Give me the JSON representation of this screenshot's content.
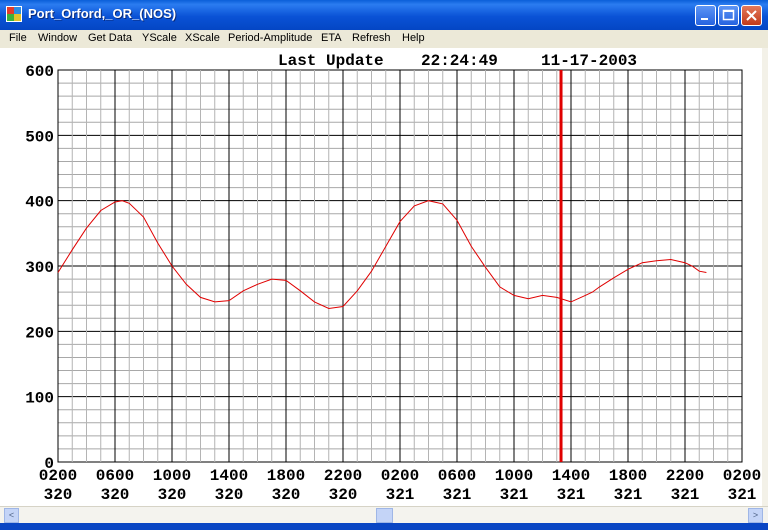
{
  "window": {
    "title": "Port_Orford,_OR_(NOS)"
  },
  "menu": [
    "File",
    "Window",
    "Get Data",
    "YScale",
    "XScale",
    "Period-Amplitude",
    "ETA",
    "Refresh",
    "Help"
  ],
  "header": {
    "label": "Last Update",
    "time": "22:24:49",
    "date": "11-17-2003"
  },
  "chart_data": {
    "type": "line",
    "y_ticks": [
      "0",
      "100",
      "200",
      "300",
      "400",
      "500",
      "600"
    ],
    "ylim": [
      0,
      600
    ],
    "x_ticks": [
      {
        "time": "0200",
        "day": "320"
      },
      {
        "time": "0600",
        "day": "320"
      },
      {
        "time": "1000",
        "day": "320"
      },
      {
        "time": "1400",
        "day": "320"
      },
      {
        "time": "1800",
        "day": "320"
      },
      {
        "time": "2200",
        "day": "320"
      },
      {
        "time": "0200",
        "day": "321"
      },
      {
        "time": "0600",
        "day": "321"
      },
      {
        "time": "1000",
        "day": "321"
      },
      {
        "time": "1400",
        "day": "321"
      },
      {
        "time": "1800",
        "day": "321"
      },
      {
        "time": "2200",
        "day": "321"
      },
      {
        "time": "0200",
        "day": "321"
      }
    ],
    "grid": true,
    "line_color": "#e00000",
    "marker_color": "#e00000",
    "marker_hours": 35.3,
    "series": [
      {
        "hours": [
          0,
          1,
          2,
          3,
          4,
          4.5,
          5,
          6,
          7,
          8,
          9,
          10,
          11,
          12,
          13,
          14,
          15,
          16,
          17,
          18,
          19,
          20,
          21,
          22,
          23,
          24,
          25,
          26,
          27,
          28,
          28.5,
          29,
          30,
          31,
          32,
          33,
          34,
          35,
          36,
          37,
          37.5,
          38,
          39,
          40,
          41,
          42,
          43,
          44,
          44.5,
          45,
          45.5
        ],
        "values": [
          290,
          325,
          358,
          385,
          398,
          400,
          396,
          375,
          335,
          300,
          272,
          252,
          245,
          247,
          262,
          272,
          280,
          278,
          262,
          245,
          235,
          238,
          262,
          292,
          330,
          368,
          392,
          400,
          395,
          370,
          350,
          330,
          298,
          268,
          255,
          250,
          255,
          252,
          245,
          255,
          260,
          268,
          282,
          295,
          305,
          308,
          310,
          305,
          300,
          292,
          290
        ]
      }
    ]
  },
  "scrollbar": {
    "left_arrow": "<",
    "right_arrow": ">"
  }
}
